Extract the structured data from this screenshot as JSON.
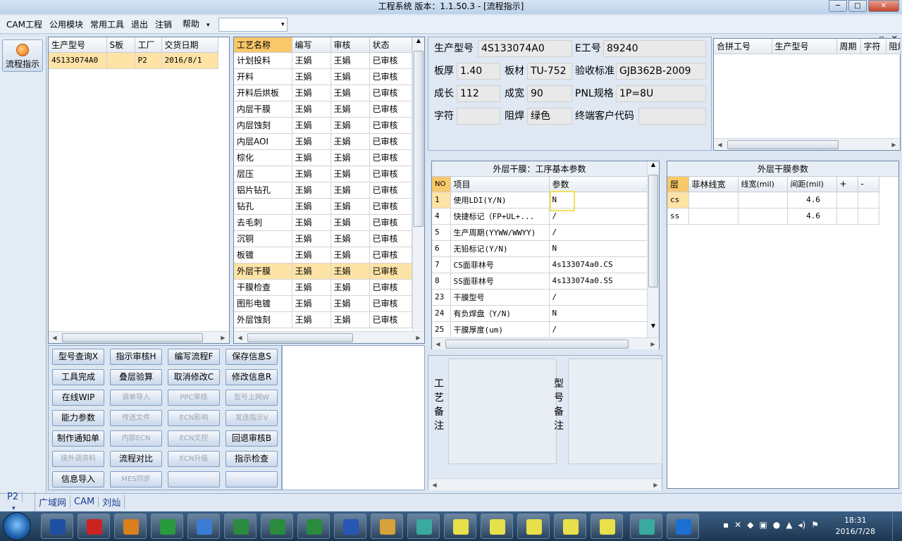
{
  "window": {
    "title": "工程系统  版本：1.1.50.3 - [流程指示]",
    "min": "─",
    "max": "□",
    "close": "✕"
  },
  "menu": [
    "CAM工程",
    "公用模块",
    "常用工具",
    "退出",
    "注销",
    "帮助"
  ],
  "menu_dropdown_arrow": "▾",
  "mdi_buttons": [
    "_",
    "▫",
    "✕"
  ],
  "left_tab": {
    "label": "流程指示"
  },
  "jobs": {
    "headers": [
      "生产型号",
      "S板",
      "工厂",
      "交货日期"
    ],
    "rows": [
      [
        "4S133074A0",
        "",
        "P2",
        "2016/8/1"
      ]
    ]
  },
  "process": {
    "headers": [
      "工艺名称",
      "编写",
      "审核",
      "状态"
    ],
    "rows": [
      [
        "计划投料",
        "王娟",
        "王娟",
        "已审核"
      ],
      [
        "开料",
        "王娟",
        "王娟",
        "已审核"
      ],
      [
        "开料后烘板",
        "王娟",
        "王娟",
        "已审核"
      ],
      [
        "内层干膜",
        "王娟",
        "王娟",
        "已审核"
      ],
      [
        "内层蚀刻",
        "王娟",
        "王娟",
        "已审核"
      ],
      [
        "内层AOI",
        "王娟",
        "王娟",
        "已审核"
      ],
      [
        "棕化",
        "王娟",
        "王娟",
        "已审核"
      ],
      [
        "层压",
        "王娟",
        "王娟",
        "已审核"
      ],
      [
        "铝片钻孔",
        "王娟",
        "王娟",
        "已审核"
      ],
      [
        "钻孔",
        "王娟",
        "王娟",
        "已审核"
      ],
      [
        "去毛刺",
        "王娟",
        "王娟",
        "已审核"
      ],
      [
        "沉铜",
        "王娟",
        "王娟",
        "已审核"
      ],
      [
        "板镀",
        "王娟",
        "王娟",
        "已审核"
      ],
      [
        "外层干膜",
        "王娟",
        "王娟",
        "已审核"
      ],
      [
        "干膜检查",
        "王娟",
        "王娟",
        "已审核"
      ],
      [
        "图形电镀",
        "王娟",
        "王娟",
        "已审核"
      ],
      [
        "外层蚀刻",
        "王娟",
        "王娟",
        "已审核"
      ]
    ],
    "selected_index": 13
  },
  "buttons": [
    {
      "label": "型号查询X",
      "enabled": true
    },
    {
      "label": "指示审核H",
      "enabled": true
    },
    {
      "label": "编写流程F",
      "enabled": true
    },
    {
      "label": "保存信息S",
      "enabled": true
    },
    {
      "label": "工具完成",
      "enabled": true
    },
    {
      "label": "叠层验算",
      "enabled": true
    },
    {
      "label": "取消修改C",
      "enabled": true
    },
    {
      "label": "修改信息R",
      "enabled": true
    },
    {
      "label": "在线WIP",
      "enabled": true
    },
    {
      "label": "调单导入",
      "enabled": false
    },
    {
      "label": "PPC审核",
      "enabled": false
    },
    {
      "label": "型号上网W",
      "enabled": false
    },
    {
      "label": "能力参数",
      "enabled": true
    },
    {
      "label": "传送文件",
      "enabled": false
    },
    {
      "label": "ECN影响",
      "enabled": false
    },
    {
      "label": "发送指示V",
      "enabled": false
    },
    {
      "label": "制作通知单",
      "enabled": true
    },
    {
      "label": "内部ECN",
      "enabled": false
    },
    {
      "label": "ECN文控",
      "enabled": false
    },
    {
      "label": "回退审核B",
      "enabled": true
    },
    {
      "label": "接外调资料",
      "enabled": false
    },
    {
      "label": "流程对比",
      "enabled": true
    },
    {
      "label": "ECN升级",
      "enabled": false
    },
    {
      "label": "指示检查",
      "enabled": true
    },
    {
      "label": "信息导入",
      "enabled": true
    },
    {
      "label": "MES同步",
      "enabled": false
    },
    {
      "label": "",
      "enabled": true
    },
    {
      "label": "",
      "enabled": true
    }
  ],
  "info": {
    "model_label": "生产型号",
    "model": "4S133074A0",
    "eno_label": "E工号",
    "eno": "89240",
    "thick_label": "板厚",
    "thick": "1.40",
    "material_label": "板材",
    "material": "TU-752",
    "std_label": "验收标准",
    "std": "GJB362B-2009",
    "len_label": "成长",
    "len": "112",
    "width_label": "成宽",
    "width": "90",
    "pnl_label": "PNL规格",
    "pnl": "1P=8U",
    "char_label": "字符",
    "char": "",
    "mask_label": "阻焊",
    "mask": "绿色",
    "cust_label": "终端客户代码",
    "cust": ""
  },
  "combine": {
    "headers": [
      "合拼工号",
      "生产型号",
      "周期",
      "字符",
      "阻焊"
    ]
  },
  "params": {
    "title": "外层干膜：工序基本参数",
    "headers": [
      "NO",
      "项目",
      "参数"
    ],
    "rows": [
      [
        "1",
        "使用LDI(Y/N)",
        "N"
      ],
      [
        "4",
        "快捷标记（FP+UL+...",
        "/"
      ],
      [
        "5",
        "生产周期(YYWW/WWYY)",
        "/"
      ],
      [
        "6",
        "无铅标记(Y/N)",
        "N"
      ],
      [
        "7",
        "CS面菲林号",
        "4s133074a0.CS"
      ],
      [
        "8",
        "SS面菲林号",
        "4s133074a0.SS"
      ],
      [
        "23",
        "干膜型号",
        "/"
      ],
      [
        "24",
        "有负焊盘（Y/N)",
        "N"
      ],
      [
        "25",
        "干膜厚度(um)",
        "/"
      ]
    ]
  },
  "film": {
    "title": "外层干膜参数",
    "headers": [
      "层",
      "菲林线宽",
      "线宽(mil)",
      "间距(mil)",
      "+",
      "-"
    ],
    "rows": [
      [
        "cs",
        "",
        "",
        "4.6",
        "",
        ""
      ],
      [
        "ss",
        "",
        "",
        "4.6",
        "",
        ""
      ]
    ]
  },
  "notes": {
    "process_label": "工艺备注",
    "model_label": "型号备注"
  },
  "status": {
    "factory": "P2",
    "arrow": "▾",
    "items": [
      "广域网",
      "CAM",
      "刘灿"
    ]
  },
  "clock": {
    "time": "18:31",
    "date": "2016/7/28"
  }
}
